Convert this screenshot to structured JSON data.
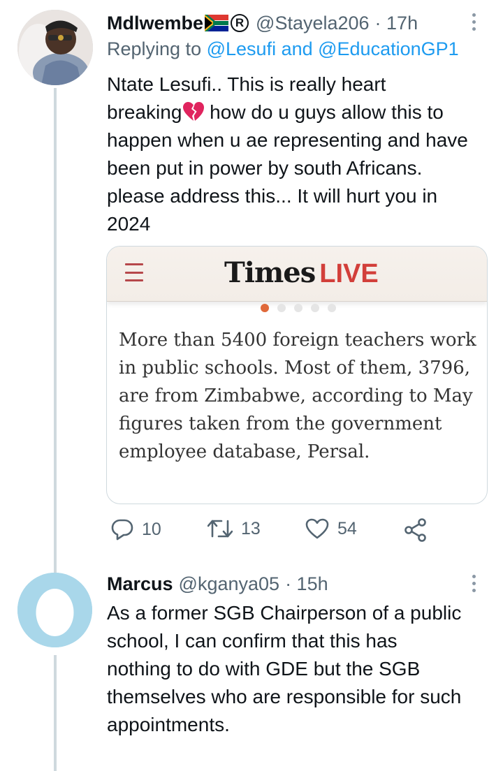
{
  "tweets": [
    {
      "display_name": "Mdlwembe",
      "handle": "@Stayela206",
      "time": "· 17h",
      "replying_prefix": "Replying to",
      "replying_to": "@Lesufi and @EducationGP1",
      "text_lines": [
        "Ntate Lesufi.. This is really heart",
        "breaking",
        " how do u guys allow this to",
        "happen when u ae representing and have",
        "been put in power by south Africans.",
        "please address this... It will hurt you in",
        "2024"
      ],
      "card": {
        "logo_times": "Times",
        "logo_live": "LIVE",
        "text_lines": [
          "More than 5400 foreign teachers work",
          "in public schools. Most of them, 3796,",
          "are from Zimbabwe, according to May",
          "figures taken from the government",
          "employee database, Persal."
        ]
      },
      "actions": {
        "replies": "10",
        "retweets": "13",
        "likes": "54"
      },
      "icons": [
        "south-africa-flag-icon",
        "registered-icon",
        "broken-heart-icon",
        "more-icon",
        "reply-icon",
        "retweet-icon",
        "like-icon",
        "share-icon"
      ]
    },
    {
      "display_name": "Marcus",
      "handle": "@kganya05",
      "time": "· 15h",
      "text_lines": [
        "As a former SGB Chairperson of a public",
        "school, I can confirm that this has",
        "nothing to do with GDE but the SGB",
        "themselves who are responsible for such",
        "appointments."
      ],
      "icons": [
        "default-egg-avatar-icon",
        "more-icon"
      ]
    }
  ],
  "colors": {
    "link": "#1d9bf0",
    "muted": "#536471",
    "thread_line": "#cfd9de",
    "live_red": "#d23f3a",
    "broken_heart": "#e0245e"
  }
}
